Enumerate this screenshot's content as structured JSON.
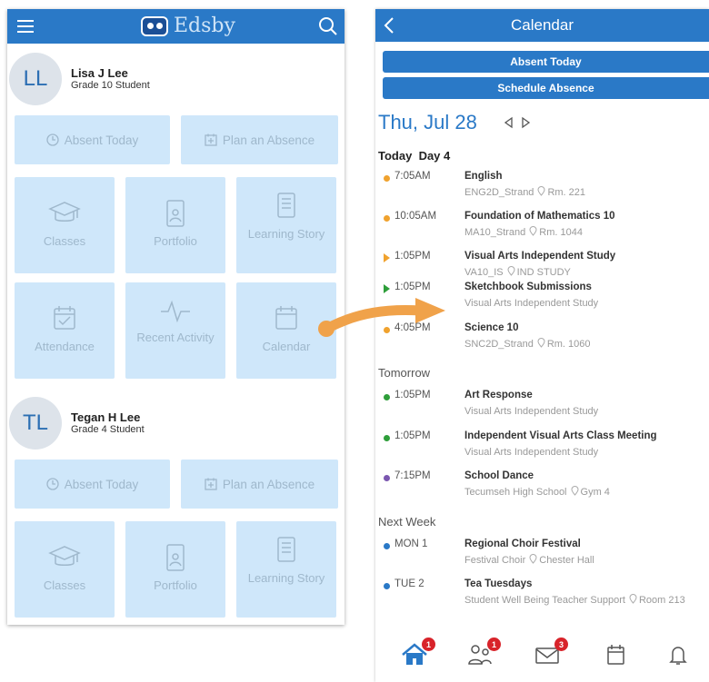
{
  "left": {
    "app_name": "Edsby",
    "students": [
      {
        "initials": "LL",
        "name": "Lisa J Lee",
        "grade": "Grade 10 Student",
        "absent_today": "Absent Today",
        "plan_absence": "Plan an Absence",
        "tiles": [
          "Classes",
          "Portfolio",
          "Learning Story",
          "Attendance",
          "Recent Activity",
          "Calendar"
        ]
      },
      {
        "initials": "TL",
        "name": "Tegan H Lee",
        "grade": "Grade 4 Student",
        "absent_today": "Absent Today",
        "plan_absence": "Plan an Absence",
        "tiles": [
          "Classes",
          "Portfolio",
          "Learning Story"
        ]
      }
    ]
  },
  "right": {
    "title": "Calendar",
    "absent_today_btn": "Absent Today",
    "schedule_absence_btn": "Schedule Absence",
    "date": "Thu, Jul 28",
    "today_label": "Today",
    "day_label": "Day 4",
    "tomorrow_label": "Tomorrow",
    "next_week_label": "Next Week",
    "events_today": [
      {
        "time": "7:05AM",
        "name": "English",
        "sub": "ENG2D_Strand",
        "loc": "Rm. 221",
        "color": "#f0a22e",
        "marker": "dot"
      },
      {
        "time": "10:05AM",
        "name": "Foundation of Mathematics 10",
        "sub": "MA10_Strand",
        "loc": "Rm. 1044",
        "color": "#f0a22e",
        "marker": "dot"
      },
      {
        "time": "1:05PM",
        "name": "Visual Arts Independent Study",
        "sub": "VA10_IS",
        "loc": "IND STUDY",
        "color": "#f0a22e",
        "marker": "triangle"
      },
      {
        "time": "1:05PM",
        "name": "Sketchbook Submissions",
        "sub": "Visual Arts Independent Study",
        "loc": "",
        "color": "#2e9e3a",
        "marker": "triangle"
      },
      {
        "time": "4:05PM",
        "name": "Science 10",
        "sub": "SNC2D_Strand",
        "loc": "Rm. 1060",
        "color": "#f0a22e",
        "marker": "dot"
      }
    ],
    "events_tomorrow": [
      {
        "time": "1:05PM",
        "name": "Art Response",
        "sub": "Visual Arts Independent Study",
        "loc": "",
        "color": "#2e9e3a"
      },
      {
        "time": "1:05PM",
        "name": "Independent Visual Arts Class Meeting",
        "sub": "Visual Arts Independent Study",
        "loc": "",
        "color": "#2e9e3a"
      },
      {
        "time": "7:15PM",
        "name": "School Dance",
        "sub": "Tecumseh High School",
        "loc": "Gym 4",
        "color": "#7b57b0"
      }
    ],
    "events_next_week": [
      {
        "time": "MON 1",
        "name": "Regional Choir Festival",
        "sub": "Festival Choir",
        "loc": "Chester Hall",
        "color": "#2a79c7"
      },
      {
        "time": "TUE 2",
        "name": "Tea Tuesdays",
        "sub": "Student Well Being Teacher Support",
        "loc": "Room 213",
        "color": "#2a79c7"
      }
    ],
    "bottom_badges": {
      "home": "1",
      "people": "1",
      "messages": "3"
    },
    "colors": {
      "accent": "#2a79c7",
      "tile": "#cfe7fa",
      "badge": "#d8232a",
      "arrow": "#f0a24a"
    }
  }
}
